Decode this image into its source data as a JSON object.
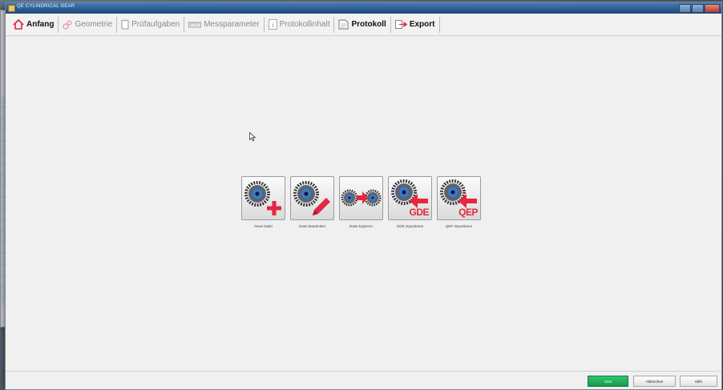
{
  "window": {
    "title": "QE CYLINDRICAL GEAR"
  },
  "tabs": [
    {
      "label": "Anfang",
      "icon": "home-icon",
      "state": "active"
    },
    {
      "label": "Geometrie",
      "icon": "gear-pair-icon",
      "state": "disabled"
    },
    {
      "label": "Prüfaufgaben",
      "icon": "clipboard-icon",
      "state": "disabled"
    },
    {
      "label": "Messparameter",
      "icon": "ruler-icon",
      "state": "disabled"
    },
    {
      "label": "Protokollinhalt",
      "icon": "info-document-icon",
      "state": "disabled"
    },
    {
      "label": "Protokoll",
      "icon": "document-icon",
      "state": "enabled"
    },
    {
      "label": "Export",
      "icon": "export-arrow-icon",
      "state": "enabled"
    }
  ],
  "actions": [
    {
      "label": "Neue Datei",
      "icon": "gear-add-icon",
      "tag": ""
    },
    {
      "label": "Datei bearbeiten",
      "icon": "gear-edit-icon",
      "tag": ""
    },
    {
      "label": "Datei kopieren",
      "icon": "gear-copy-icon",
      "tag": ""
    },
    {
      "label": "GDE importieren",
      "icon": "gear-import-icon",
      "tag": "GDE"
    },
    {
      "label": "QEP importieren",
      "icon": "gear-import-icon",
      "tag": "QEP"
    }
  ],
  "footer": {
    "ok_label": "Start",
    "cancel_label": "Abbrechen",
    "help_label": "Hilfe"
  },
  "colors": {
    "accent_red": "#e5273f",
    "ok_green": "#1fae5a",
    "titlebar_blue": "#2b5c92"
  }
}
